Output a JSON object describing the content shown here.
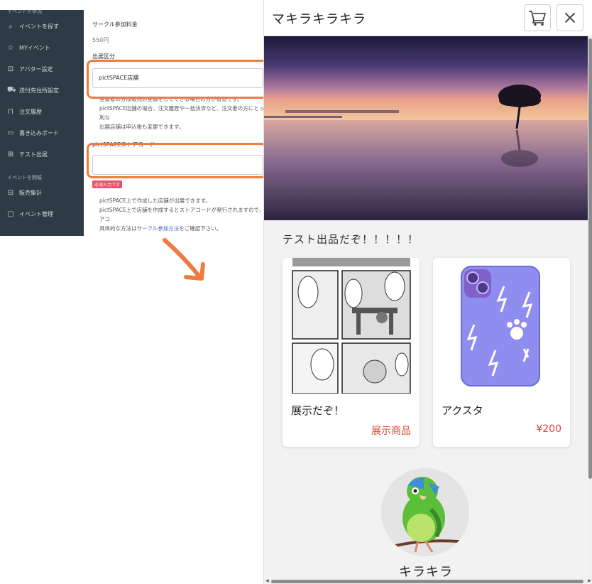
{
  "settings_panel": {
    "sidebar": {
      "section_participation": "イベントを参加",
      "items": [
        {
          "label": "イベントを探す",
          "icon": "search-icon"
        },
        {
          "label": "MYイベント",
          "icon": "star-icon"
        },
        {
          "label": "アバター設定",
          "icon": "lock-icon"
        },
        {
          "label": "送付先住所設定",
          "icon": "truck-icon"
        },
        {
          "label": "注文履歴",
          "icon": "bag-icon"
        },
        {
          "label": "書き込みボード",
          "icon": "chat-icon"
        },
        {
          "label": "テスト出展",
          "icon": "store-icon"
        }
      ],
      "section_host": "イベントを開催",
      "host_items": [
        {
          "label": "販売集計",
          "icon": "chart-icon"
        },
        {
          "label": "イベント管理",
          "icon": "folder-icon"
        }
      ]
    },
    "form": {
      "fee_label": "サークル参加料金",
      "fee_value": "550円",
      "type_label": "出展区分",
      "type_value": "pictSPACE店舗",
      "help1_line1": "登録者の方は販売の登録をしてできる場合の方が有効です。",
      "help1_line2": "pictSPACE店舗の場合、注文履歴や一括決済など、注文者の方にとって便利な",
      "help1_line3": "出展店舗は申込後も変更できます。",
      "code_label": "pictSPACEストアコード",
      "code_value": "",
      "required_badge": "必須入力です",
      "help2_line1": "pictSPACE上で作成した店舗が出展できます。",
      "help2_line2": "pictSPACE上で店舗を作成するとストアコードが発行されますので、ストアコ",
      "help2_line3_pre": "具体的な方法は",
      "help2_line3_link": "サークル参加方法",
      "help2_line3_post": "をご確認下さい。"
    }
  },
  "shop": {
    "title": "マキラキラキラ",
    "section_title": "テスト出品だぞ！！！！！",
    "products": [
      {
        "name": "展示だぞ！",
        "price": "展示商品"
      },
      {
        "name": "アクスタ",
        "price": "¥200"
      }
    ],
    "user_name": "キラキラ"
  },
  "colors": {
    "highlight": "#f07b3f",
    "price": "#d9453a",
    "sidebar_bg": "#2e3a46",
    "link": "#4a5fc1"
  }
}
